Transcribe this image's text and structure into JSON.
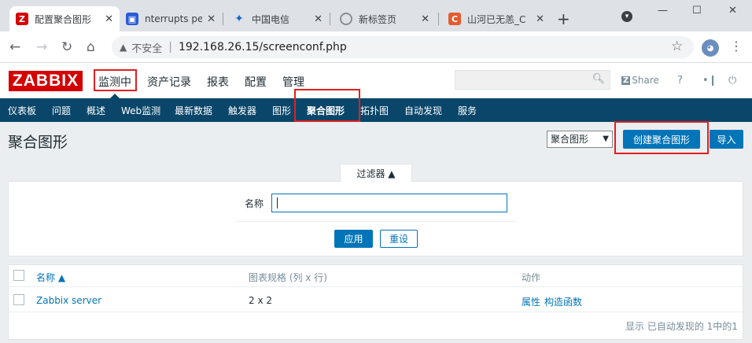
{
  "browser": {
    "tabs": [
      {
        "title": "配置聚合图形",
        "fav": "Z",
        "color": "#d40000",
        "active": true
      },
      {
        "title": "nterrupts per",
        "fav": "",
        "color": "#2a5bd7",
        "active": false
      },
      {
        "title": "中国电信",
        "fav": "✦",
        "color": "#1a66c9",
        "active": false
      },
      {
        "title": "新标签页",
        "fav": "",
        "color": "#8a8f95",
        "active": false
      },
      {
        "title": "山河已无恙_C",
        "fav": "C",
        "color": "#e25c2f",
        "active": false
      }
    ],
    "new_tab": "+",
    "window_controls": {
      "dropdown": "▾",
      "minimize": "—",
      "maximize": "☐",
      "close": "✕"
    },
    "security_label": "不安全",
    "url": "192.168.26.15/screenconf.php"
  },
  "app": {
    "logo": "ZABBIX",
    "top_menu": [
      "监测中",
      "资产记录",
      "报表",
      "配置",
      "管理"
    ],
    "share": "Share",
    "help": "?",
    "sub_menu": [
      "仪表板",
      "问题",
      "概述",
      "Web监测",
      "最新数据",
      "触发器",
      "图形",
      "聚合图形",
      "拓扑图",
      "自动发现",
      "服务"
    ],
    "page_title": "聚合图形",
    "view_select": "聚合图形",
    "create_button": "创建聚合图形",
    "import_button": "导入",
    "filter": {
      "tab_label": "过滤器 ▲",
      "name_label": "名称",
      "name_value": "",
      "apply": "应用",
      "reset": "重设"
    },
    "table": {
      "headers": [
        "名称 ▲",
        "图表规格 (列 x 行)",
        "动作"
      ],
      "rows": [
        {
          "name": "Zabbix server",
          "size": "2 x 2",
          "action1": "属性",
          "action2": "构造函数"
        }
      ],
      "footer": "显示 已自动发现的 1中的1"
    }
  }
}
